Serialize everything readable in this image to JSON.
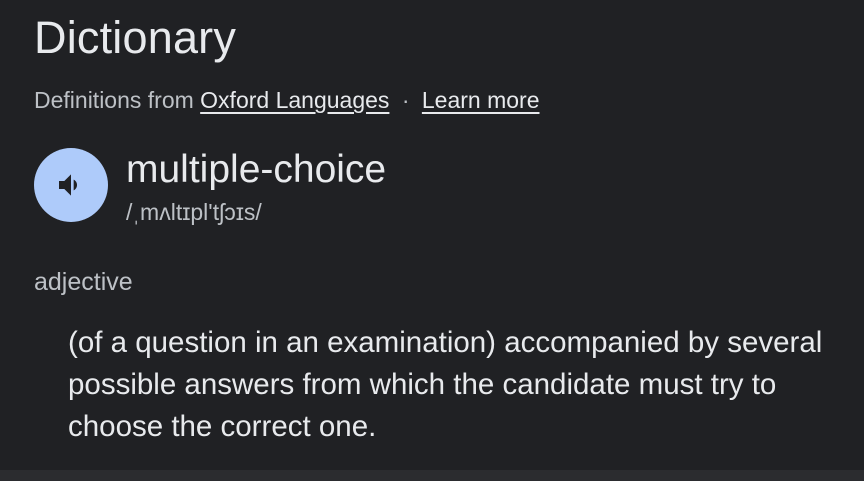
{
  "header": {
    "title": "Dictionary",
    "source_prefix": "Definitions from",
    "source_link": "Oxford Languages",
    "separator": "·",
    "learn_more": "Learn more"
  },
  "entry": {
    "word": "multiple-choice",
    "phonetic": "/ˌmʌltɪpl'tʃɔɪs/",
    "audio_icon": "speaker-icon",
    "part_of_speech": "adjective",
    "definition": "(of a question in an examination) accompanied by several possible answers from which the candidate must try to choose the correct one."
  },
  "colors": {
    "background": "#202124",
    "text_primary": "#e8eaed",
    "text_secondary": "#bdc1c6",
    "audio_button": "#aecbfa",
    "audio_icon": "#202124"
  }
}
